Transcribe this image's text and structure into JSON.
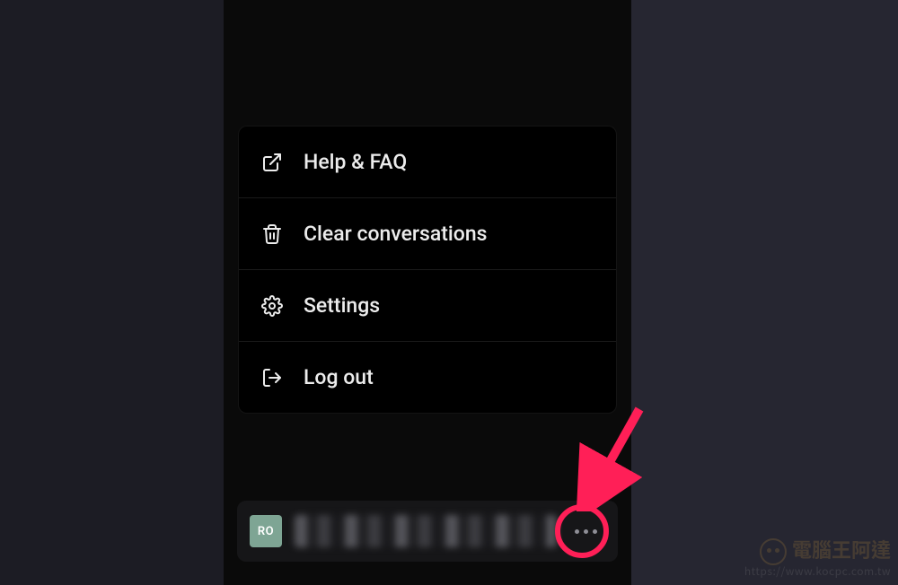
{
  "menu": {
    "help_faq": "Help & FAQ",
    "clear_conversations": "Clear conversations",
    "settings": "Settings",
    "log_out": "Log out"
  },
  "profile": {
    "avatar_initials": "RO",
    "email_obscured": "[redacted]"
  },
  "annotation": {
    "highlight_color": "#ff1f57"
  },
  "watermark": {
    "title": "電腦王阿達",
    "url": "https://www.kocpc.com.tw"
  }
}
